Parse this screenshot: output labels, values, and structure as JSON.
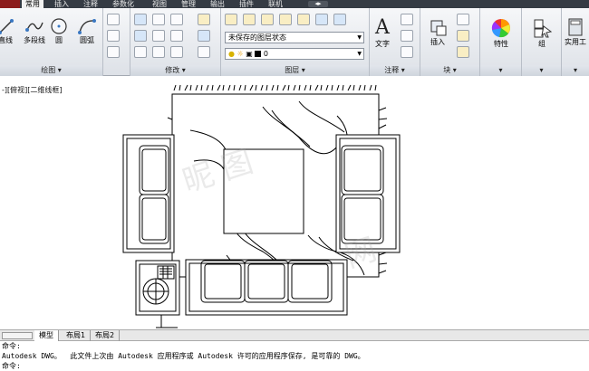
{
  "menu": {
    "tabs": [
      "常用",
      "插入",
      "注释",
      "参数化",
      "视图",
      "管理",
      "输出",
      "插件",
      "联机"
    ],
    "active": "常用"
  },
  "ribbon": {
    "draw": {
      "title": "绘图 ▾",
      "line": "直线",
      "polyline": "多段线",
      "circle": "圆",
      "arc": "圆弧"
    },
    "modify": {
      "title": "修改 ▾"
    },
    "layers": {
      "title": "图层 ▾",
      "state_value": "未保存的图层状态",
      "layer_value": "0"
    },
    "annotation": {
      "title": "注释 ▾",
      "text": "文字"
    },
    "block": {
      "title": "块 ▾",
      "insert": "插入"
    },
    "properties": {
      "title": "特性"
    },
    "groups": {
      "title": "组"
    },
    "utilities": {
      "title": "实用工"
    }
  },
  "viewport": {
    "label": "-][俯视][二维线框]"
  },
  "layout_tabs": [
    "模型",
    "布局1",
    "布局2"
  ],
  "command": {
    "lines": [
      "命令:",
      "Autodesk DWG。  此文件上次由 Autodesk 应用程序或 Autodesk 许可的应用程序保存, 是可靠的 DWG。",
      "命令:"
    ]
  },
  "colors": {
    "menubar": "#353b44",
    "ribbon": "#e4e8ee"
  }
}
